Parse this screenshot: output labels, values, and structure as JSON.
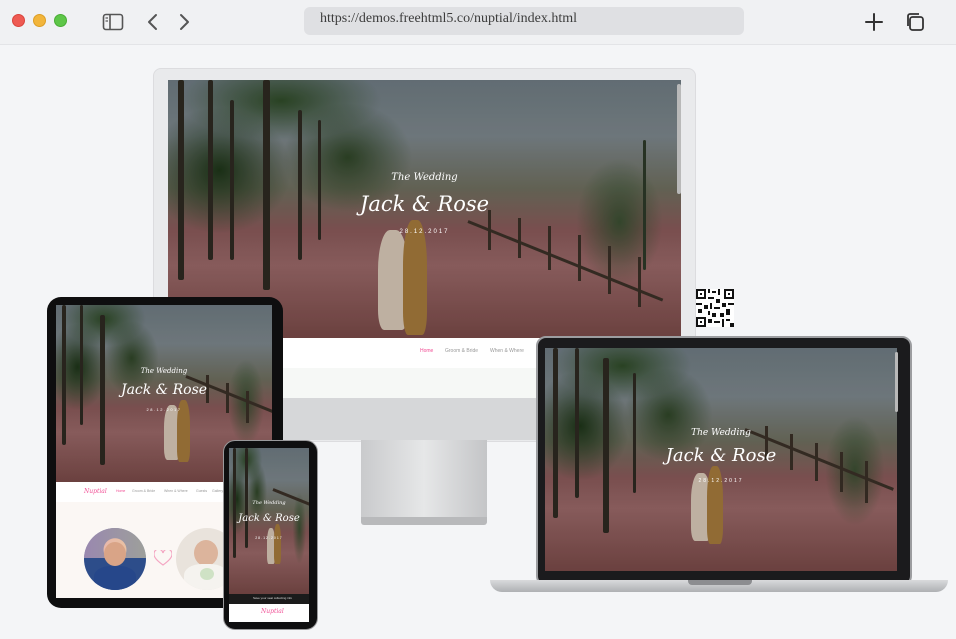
{
  "browser": {
    "url": "https://demos.freehtml5.co/nuptial/index.html",
    "icons": [
      "sidebar-icon",
      "back-icon",
      "forward-icon",
      "new-tab-icon",
      "tabs-overview-icon"
    ]
  },
  "hero": {
    "kicker": "The Wedding",
    "names": "Jack & Rose",
    "date": "28.12.2017"
  },
  "site_nav": {
    "brand": "Nuptial",
    "items": [
      "Home",
      "Groom & Bride",
      "When & Where",
      "Guests",
      "Gallery"
    ],
    "active_color": "#f14e95"
  },
  "phone_notice": "Save your seat collecting info",
  "colors": {
    "accent": "#f14e95",
    "chrome": "#f0f1f3",
    "url_bar": "#dfe0e3"
  }
}
